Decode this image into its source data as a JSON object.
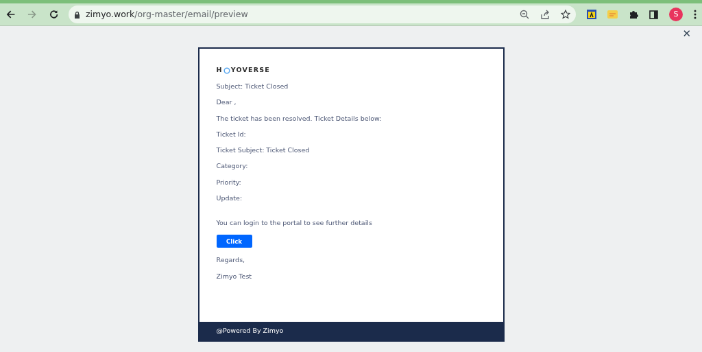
{
  "browser": {
    "address": {
      "host": "zimyo.work",
      "path": "/org-master/email/preview"
    },
    "profile_initial": "S"
  },
  "close_label": "✕",
  "email": {
    "logo": {
      "before": "H",
      "after": "YOVERSE"
    },
    "lines": [
      {
        "kind": "text",
        "text": "Subject: Ticket Closed"
      },
      {
        "kind": "text",
        "text": "Dear ,"
      },
      {
        "kind": "text",
        "text": "The ticket has been resolved. Ticket Details below:"
      },
      {
        "kind": "text",
        "text": "Ticket Id:"
      },
      {
        "kind": "text",
        "text": "Ticket Subject: Ticket Closed"
      },
      {
        "kind": "text",
        "text": "Category:"
      },
      {
        "kind": "text",
        "text": "Priority:"
      },
      {
        "kind": "text",
        "text": "Update:"
      },
      {
        "kind": "gap",
        "text": "You can login to the portal to see further details"
      },
      {
        "kind": "button",
        "text": "Click"
      },
      {
        "kind": "text",
        "text": "Regards,"
      },
      {
        "kind": "text",
        "text": "Zimyo Test"
      }
    ],
    "footer": "@Powered By Zimyo"
  }
}
